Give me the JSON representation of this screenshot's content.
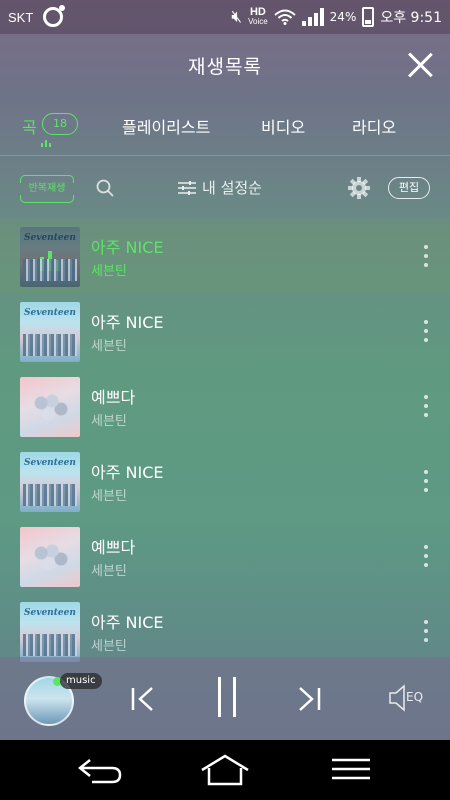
{
  "status_bar": {
    "carrier": "SKT",
    "hd_label": "HD",
    "hd_sub": "Voice",
    "battery_pct": "24%",
    "time": "오후 9:51"
  },
  "header": {
    "title": "재생목록"
  },
  "tabs": [
    {
      "label": "곡",
      "badge": "18",
      "active": true
    },
    {
      "label": "플레이리스트"
    },
    {
      "label": "비디오"
    },
    {
      "label": "라디오"
    }
  ],
  "toolbar": {
    "repeat_label": "반복재생",
    "sort_label": "내 설정순",
    "edit_label": "편집"
  },
  "songs": [
    {
      "title": "아주 NICE",
      "artist": "세븐틴",
      "cover": "nice",
      "playing": true
    },
    {
      "title": "아주 NICE",
      "artist": "세븐틴",
      "cover": "nice"
    },
    {
      "title": "예쁘다",
      "artist": "세븐틴",
      "cover": "pretty"
    },
    {
      "title": "아주 NICE",
      "artist": "세븐틴",
      "cover": "nice"
    },
    {
      "title": "예쁘다",
      "artist": "세븐틴",
      "cover": "pretty"
    },
    {
      "title": "아주 NICE",
      "artist": "세븐틴",
      "cover": "nice"
    }
  ],
  "player": {
    "tag": "music",
    "eq_label": "EQ"
  },
  "colors": {
    "accent": "#5ee36a"
  }
}
